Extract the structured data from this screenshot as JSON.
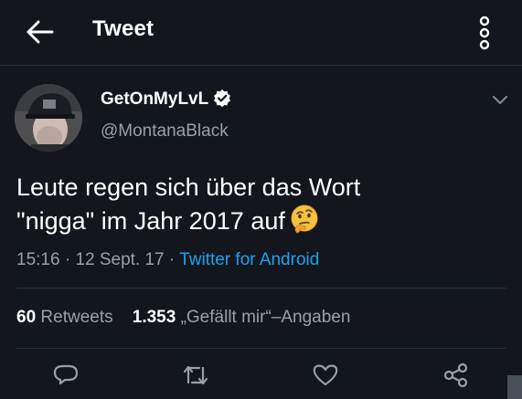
{
  "header": {
    "title": "Tweet",
    "back_icon": "arrow-left-icon",
    "menu_icon": "more-vertical-icon"
  },
  "author": {
    "display_name": "GetOnMyLvL",
    "handle": "@MontanaBlack",
    "verified": true
  },
  "tweet": {
    "text_line1": "Leute regen sich über das Wort",
    "text_line2": "\"nigga\" im Jahr 2017 auf",
    "emoji": "thinking-face-emoji",
    "time": "15:16",
    "date": "12 Sept. 17",
    "separator": "·",
    "source": "Twitter for Android"
  },
  "stats": {
    "retweets_count": "60",
    "retweets_label": "Retweets",
    "likes_count": "1.353",
    "likes_label": "„Gefällt mir“–Angaben"
  },
  "actions": [
    "reply-icon",
    "retweet-icon",
    "like-heart-icon",
    "share-icon"
  ],
  "colors": {
    "background": "#13171d",
    "text": "#ffffff",
    "secondary_text": "#98a0a8",
    "link": "#1da1f2",
    "divider": "#2a3038",
    "verified_badge": "#ffffff"
  }
}
